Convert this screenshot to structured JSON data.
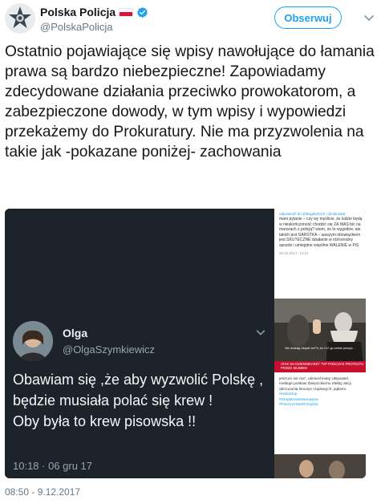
{
  "account": {
    "display_name": "Polska Policja",
    "handle": "@PolskaPolicja",
    "flag_colors": {
      "top": "#ffffff",
      "bottom": "#dc143c"
    },
    "verified_color": "#1da1f2",
    "avatar_icon": "police-star-badge-icon"
  },
  "follow": {
    "label": "Obserwuj",
    "color": "#1da1f2"
  },
  "tweet": {
    "text": "Ostatnio pojawiające się wpisy nawołujące do łamania prawa są bardzo niebezpieczne! Zapowiadamy zdecydowane działania przeciwko prowokatorom, a zabezpieczone dowody, w tym wpisy i wypowiedzi przekażemy do Prokuratury. Nie ma przyzwolenia na takie jak -pokazane poniżej- zachowania",
    "timestamp": "08:50 - 9.12.2017"
  },
  "embedded_tweet": {
    "name": "Olga",
    "handle": "@OlgaSzymkiewicz",
    "text": "Obawiam się ,że aby wyzwolić Polskę , będzie musiała polać się krew !\nOby była to krew pisowska !!",
    "timestamp": "10:18 · 06 gru 17"
  },
  "side_top": {
    "mention": "odpowiedź do @BogdanOch i @ulaniuk8",
    "body": "mam pytanie – czy wy myślicie, że ludzie będą w nieskończoność chodzić się ZA WAS bić na marszach z policją? wiem, że to wygodne, ale takich jest GARSTKA – waszym obowiązkiem jest SKUTECZNE działanie w różnorodny sposób i umiejętne wspólne WALENIE w PiS",
    "date": "08.12.2017, 14:24"
  },
  "side_video": {
    "caption": "Nie dostaję ekspie bo**h, bo Cz* go zetnie prezyd...",
    "bar_text": "ATAK NA DZIENNIKARZY TVP PODCZAS PROTESTU PRZED SEJMEM"
  },
  "side_bottom": {
    "body": "jeszcze nie ma\", uśmiechnięty UBywatel, mełduje posłowi Święcickiemu efekty akcji, obrzucania limuzyn rządowych, jajkami.",
    "tags": [
      "#HaloStop",
      "#StopMowieNienawisci",
      "#FaszyzmNiePrzejdzie"
    ]
  }
}
